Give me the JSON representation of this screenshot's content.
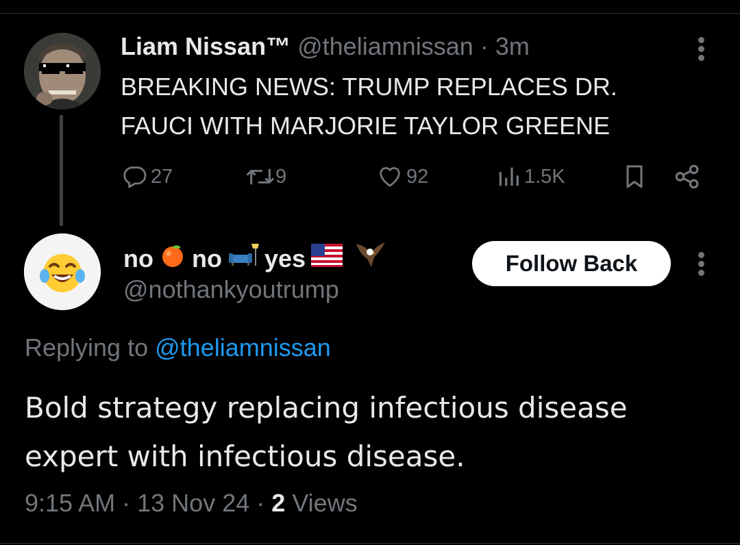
{
  "parent_tweet": {
    "display_name": "Liam Nissan™",
    "handle": "@theliamnissan",
    "separator": "·",
    "time": "3m",
    "text": "BREAKING NEWS: TRUMP REPLACES DR. FAUCI WITH MARJORIE TAYLOR GREENE",
    "actions": {
      "replies": "27",
      "reposts": "9",
      "likes": "92",
      "views": "1.5K"
    }
  },
  "reply_tweet": {
    "name_parts": [
      "no",
      "no",
      "yes"
    ],
    "handle": "@nothankyoutrump",
    "follow_label": "Follow Back",
    "replying_prefix": "Replying to",
    "replying_handle": "@theliamnissan",
    "text": "Bold strategy replacing infectious disease expert with infectious disease.",
    "time": "9:15 AM",
    "date": "13 Nov 24",
    "separator": "·",
    "views_count": "2",
    "views_label": "Views"
  },
  "icons": {
    "reply": "reply-icon",
    "repost": "repost-icon",
    "like": "heart-icon",
    "views": "views-bar-icon",
    "bookmark": "bookmark-icon",
    "share": "share-icon",
    "more": "more-dots-icon"
  },
  "colors": {
    "background": "#000000",
    "text": "#e7e9ea",
    "muted": "#71767b",
    "link": "#1d9bf0",
    "button_bg": "#ffffff"
  }
}
